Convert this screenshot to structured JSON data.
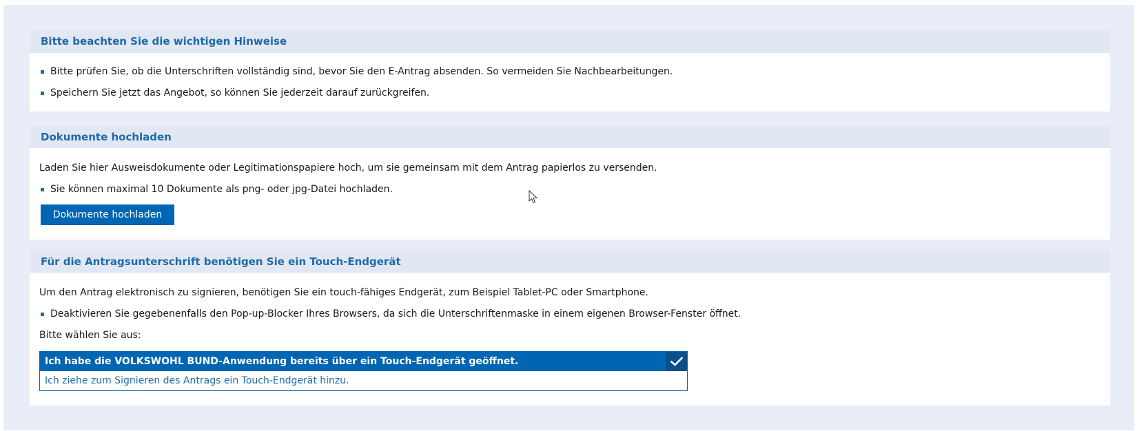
{
  "notes": {
    "title": "Bitte beachten Sie die wichtigen Hinweise",
    "items": [
      "Bitte prüfen Sie, ob die Unterschriften vollständig sind, bevor Sie den E-Antrag absenden. So vermeiden Sie Nachbearbeitungen.",
      "Speichern Sie jetzt das Angebot, so können Sie jederzeit darauf zurückgreifen."
    ]
  },
  "upload": {
    "title": "Dokumente hochladen",
    "intro": "Laden Sie hier Ausweisdokumente oder Legitimationspapiere hoch, um sie gemeinsam mit dem Antrag papierlos zu versenden.",
    "items": [
      "Sie können maximal 10 Dokumente als png- oder jpg-Datei hochladen."
    ],
    "button_label": "Dokumente hochladen"
  },
  "signature": {
    "title": "Für die Antragsunterschrift benötigen Sie ein Touch-Endgerät",
    "intro": "Um den Antrag elektronisch zu signieren, benötigen Sie ein touch-fähiges Endgerät, zum Beispiel Tablet-PC oder Smartphone.",
    "items": [
      "Deaktivieren Sie gegebenenfalls den Pop-up-Blocker Ihres Browsers, da sich die Unterschriftenmaske in einem eigenen Browser-Fenster öffnet."
    ],
    "select_prompt": "Bitte wählen Sie aus:",
    "options": [
      {
        "label": "Ich habe die VOLKSWOHL BUND-Anwendung bereits über ein Touch-Endgerät geöffnet.",
        "selected": true,
        "icon": "checkmark-icon"
      },
      {
        "label": "Ich ziehe zum Signieren des Antrags ein Touch-Endgerät hinzu.",
        "selected": false
      }
    ]
  },
  "colors": {
    "page_background": "#e8edf7",
    "section_header": "#e1e7f3",
    "accent": "#0066b3",
    "title_text": "#1f6aa6"
  }
}
